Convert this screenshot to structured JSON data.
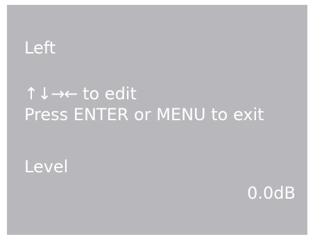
{
  "screen": {
    "background_color": "#b8b8bc",
    "text_color": "#ffffff",
    "channel_label": "Left",
    "edit_arrows": "↑↓→←",
    "edit_hint": "to edit",
    "exit_hint": "Press ENTER or MENU to exit",
    "parameter_label": "Level",
    "parameter_value": "0.0dB"
  }
}
